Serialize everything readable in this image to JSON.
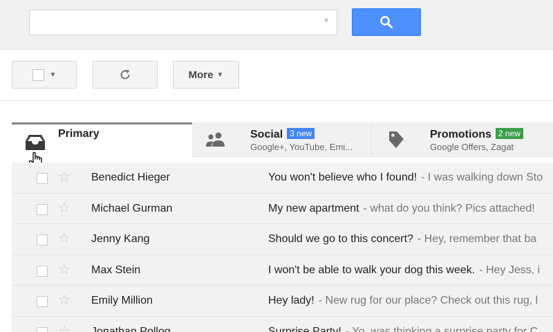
{
  "search": {
    "value": "",
    "placeholder": "",
    "icon": "search-icon",
    "button_color": "#4d90fe"
  },
  "toolbar": {
    "more_label": "More",
    "select_caret": "▼",
    "more_caret": "▼",
    "refresh_glyph": "↻"
  },
  "tabs": [
    {
      "label": "Primary",
      "icon": "inbox-icon",
      "badge": "",
      "sub": ""
    },
    {
      "label": "Social",
      "icon": "people-icon",
      "badge": "3 new",
      "badge_color": "#4285f4",
      "sub": "Google+, YouTube, Emi..."
    },
    {
      "label": "Promotions",
      "icon": "tag-icon",
      "badge": "2 new",
      "badge_color": "#3d9e4a",
      "sub": "Google Offers, Zagat"
    }
  ],
  "emails": [
    {
      "sender": "Benedict Hieger",
      "subject": "You won't believe who I found!",
      "snippet": "- I was walking down Sto"
    },
    {
      "sender": "Michael Gurman",
      "subject": "My new apartment",
      "snippet": "- what do you think? Pics attached!"
    },
    {
      "sender": "Jenny Kang",
      "subject": "Should we go to this concert?",
      "snippet": "- Hey, remember that ba"
    },
    {
      "sender": "Max Stein",
      "subject": "I won't be able to walk your dog this week.",
      "snippet": "- Hey Jess, i"
    },
    {
      "sender": "Emily Million",
      "subject": "Hey lady!",
      "snippet": "- New rug for our place? Check out this rug, l"
    },
    {
      "sender": "Jonathan Pollog",
      "subject": "Surprise Party!",
      "snippet": "- Yo, was thinking a surprise party for C"
    }
  ]
}
